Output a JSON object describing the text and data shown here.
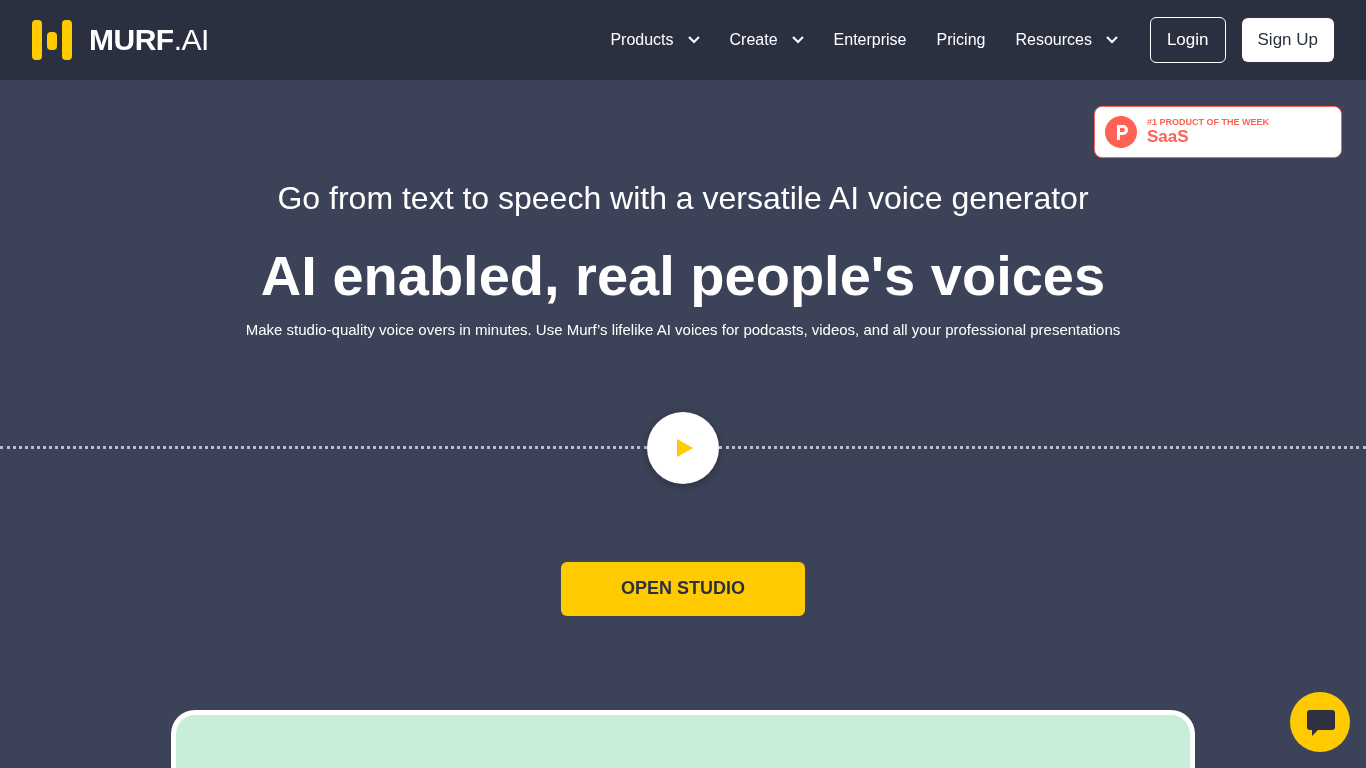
{
  "header": {
    "logo": {
      "wordmark": "MURF",
      "suffix": ".AI"
    },
    "nav": [
      {
        "label": "Products",
        "dropdown": true
      },
      {
        "label": "Create",
        "dropdown": true
      },
      {
        "label": "Enterprise",
        "dropdown": false
      },
      {
        "label": "Pricing",
        "dropdown": false
      },
      {
        "label": "Resources",
        "dropdown": true
      }
    ],
    "login": "Login",
    "signup": "Sign Up"
  },
  "badge": {
    "eyebrow": "#1 PRODUCT OF THE WEEK",
    "title": "SaaS"
  },
  "hero": {
    "subtitle": "Go from text to speech with a versatile AI voice generator",
    "headline": "AI enabled, real people's voices",
    "description": "Make studio-quality voice overs in minutes. Use Murf’s lifelike AI voices for podcasts, videos, and all your professional presentations",
    "cta": "OPEN STUDIO"
  }
}
